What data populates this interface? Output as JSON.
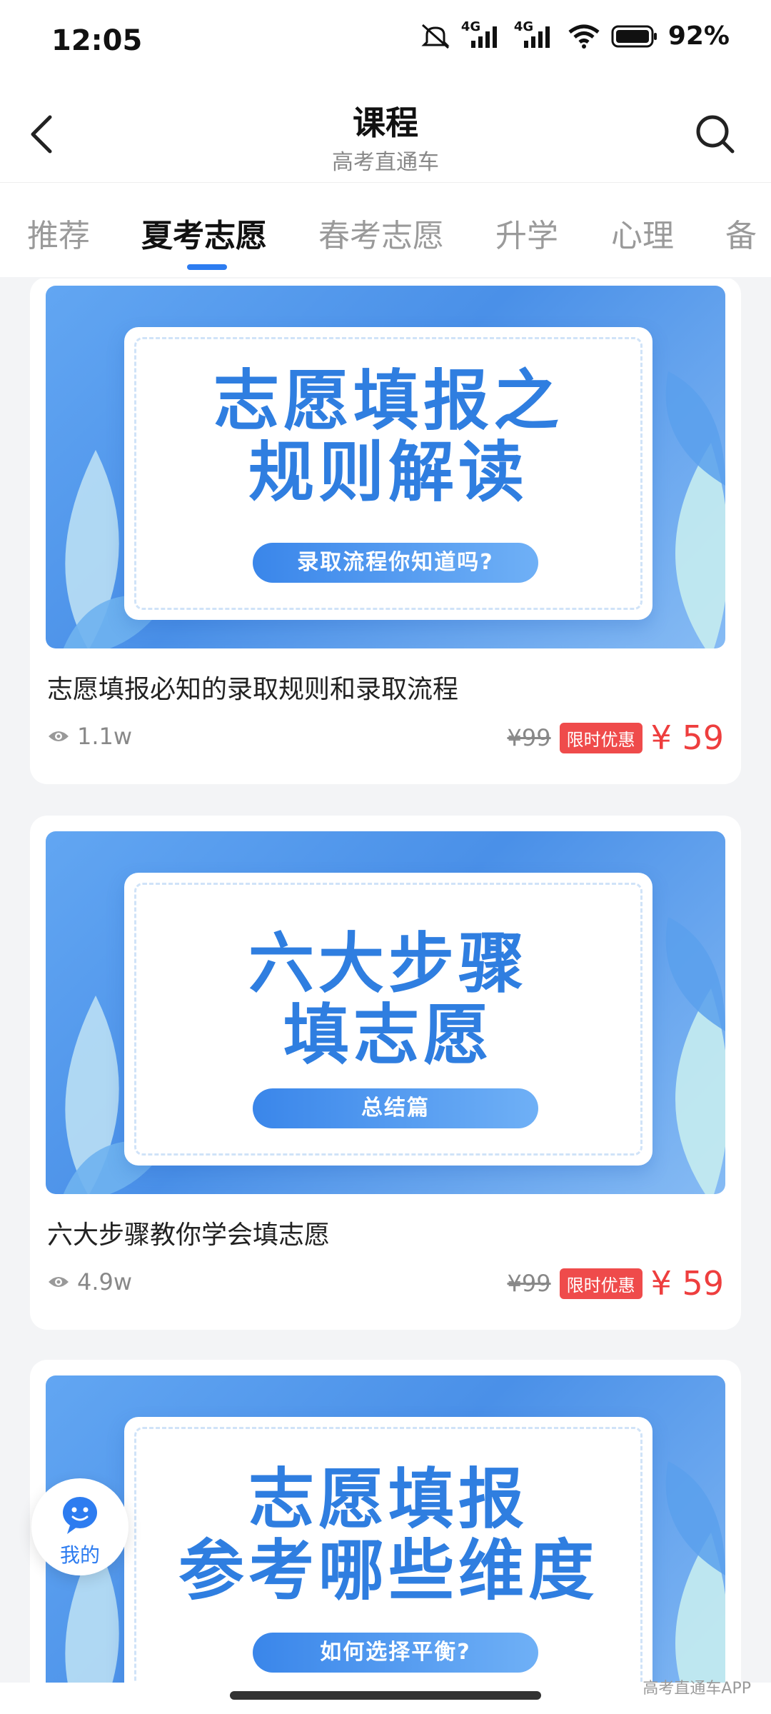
{
  "status": {
    "time": "12:05",
    "net1": "4G",
    "net2": "4G",
    "battery": "92%"
  },
  "header": {
    "title": "课程",
    "subtitle": "高考直通车"
  },
  "tabs": [
    {
      "label": "推荐"
    },
    {
      "label": "夏考志愿"
    },
    {
      "label": "春考志愿"
    },
    {
      "label": "升学"
    },
    {
      "label": "心理"
    },
    {
      "label": "备"
    }
  ],
  "courses": [
    {
      "banner_line1": "志愿填报之",
      "banner_line2": "规则解读",
      "banner_pill": "录取流程你知道吗?",
      "title": "志愿填报必知的录取规则和录取流程",
      "views": "1.1w",
      "old_price": "¥99",
      "badge": "限时优惠",
      "price": "¥ 59"
    },
    {
      "banner_line1": "六大步骤",
      "banner_line2": "填志愿",
      "banner_pill": "总结篇",
      "title": "六大步骤教你学会填志愿",
      "views": "4.9w",
      "old_price": "¥99",
      "badge": "限时优惠",
      "price": "¥ 59"
    },
    {
      "banner_line1": "志愿填报",
      "banner_line2": "参考哪些维度",
      "banner_pill": "如何选择平衡?",
      "title": "",
      "views": "",
      "old_price": "",
      "badge": "",
      "price": ""
    }
  ],
  "float_button": {
    "label": "我的"
  },
  "watermark": "高考直通车APP",
  "colors": {
    "accent": "#2d7cf0",
    "price": "#ee3e3e",
    "badge": "#ef4b4b"
  }
}
